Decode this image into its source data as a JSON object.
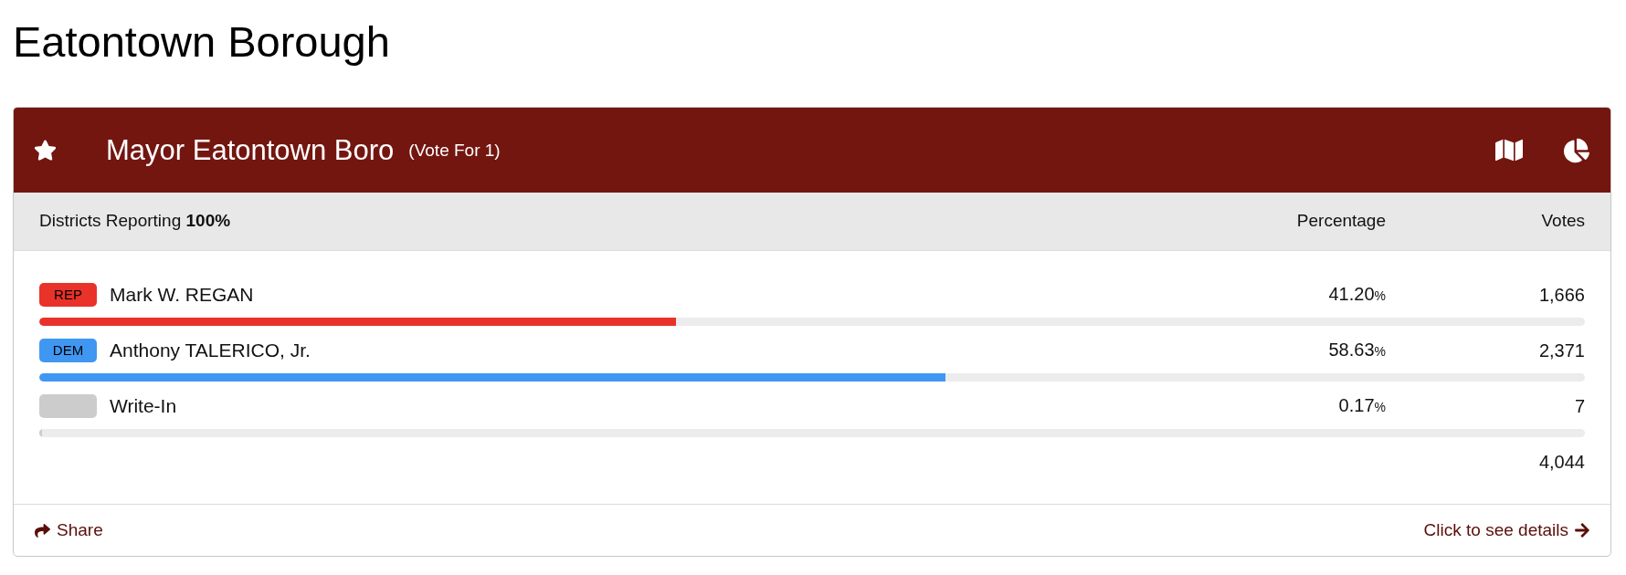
{
  "page_title": "Eatontown Borough",
  "contest": {
    "title": "Mayor Eatontown Boro",
    "vote_for": "(Vote For 1)"
  },
  "summary": {
    "reporting": "Districts Reporting **100%**",
    "columns": [
      "Percentage",
      "Votes"
    ]
  },
  "candidates": [
    {
      "party": "REP",
      "name": "Mark W. REGAN",
      "color": "#e8322a",
      "percentage": "41.20",
      "percentage_unit": "%",
      "votes": "1,666",
      "level": 0.412
    },
    {
      "party": "DEM",
      "name": "Anthony TALERICO, Jr.",
      "color": "#3f97f2",
      "percentage": "58.63",
      "percentage_unit": "%",
      "votes": "2,371",
      "level": 0.5863
    },
    {
      "name": "Write-In",
      "color": "#cccccc",
      "percentage": "0.17",
      "percentage_unit": "%",
      "votes": "7",
      "level": 0.0017
    }
  ],
  "total_votes": "4,044",
  "footer": {
    "share": "Share",
    "details": "Click to see details"
  }
}
